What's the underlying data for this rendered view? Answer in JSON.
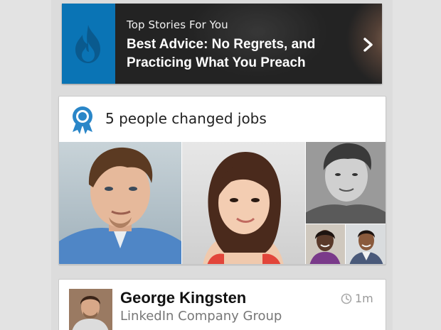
{
  "top_stories": {
    "kicker": "Top Stories For You",
    "headline": "Best Advice: No Regrets, and Practicing What You Preach",
    "icon": "flame-icon",
    "brand_color": "#0a74b5"
  },
  "jobs_card": {
    "title": "5 people changed jobs",
    "icon": "award-ribbon-icon",
    "accent": "#2a86c8"
  },
  "update_card": {
    "name": "George Kingsten",
    "subtitle": "LinkedIn Company Group",
    "time": "1m",
    "time_icon": "clock-icon"
  }
}
